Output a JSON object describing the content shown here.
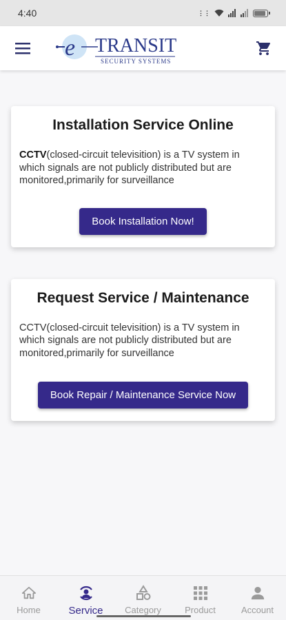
{
  "status_bar": {
    "time": "4:40",
    "battery": "97"
  },
  "header": {
    "logo_letter": "e",
    "logo_word": "TRANSIT",
    "logo_tagline": "SECURITY SYSTEMS"
  },
  "cards": [
    {
      "title": "Installation Service Online",
      "desc_bold": "CCTV",
      "desc_rest": "(closed-circuit televisition) is a TV system in which signals are not publicly distributed but are monitored,primarily for surveillance",
      "button": "Book Installation Now!"
    },
    {
      "title": "Request Service / Maintenance",
      "desc": "CCTV(closed-circuit televisition) is a TV system in which signals are not publicly distributed but are monitored,primarily for surveillance",
      "button": "Book Repair / Maintenance Service Now"
    }
  ],
  "nav": {
    "items": [
      {
        "label": "Home",
        "icon": "home-icon"
      },
      {
        "label": "Service",
        "icon": "service-icon",
        "active": true
      },
      {
        "label": "Category",
        "icon": "category-icon"
      },
      {
        "label": "Product",
        "icon": "product-grid-icon"
      },
      {
        "label": "Account",
        "icon": "account-icon"
      }
    ]
  },
  "colors": {
    "accent": "#35298a",
    "inactive": "#9a9a9a"
  }
}
